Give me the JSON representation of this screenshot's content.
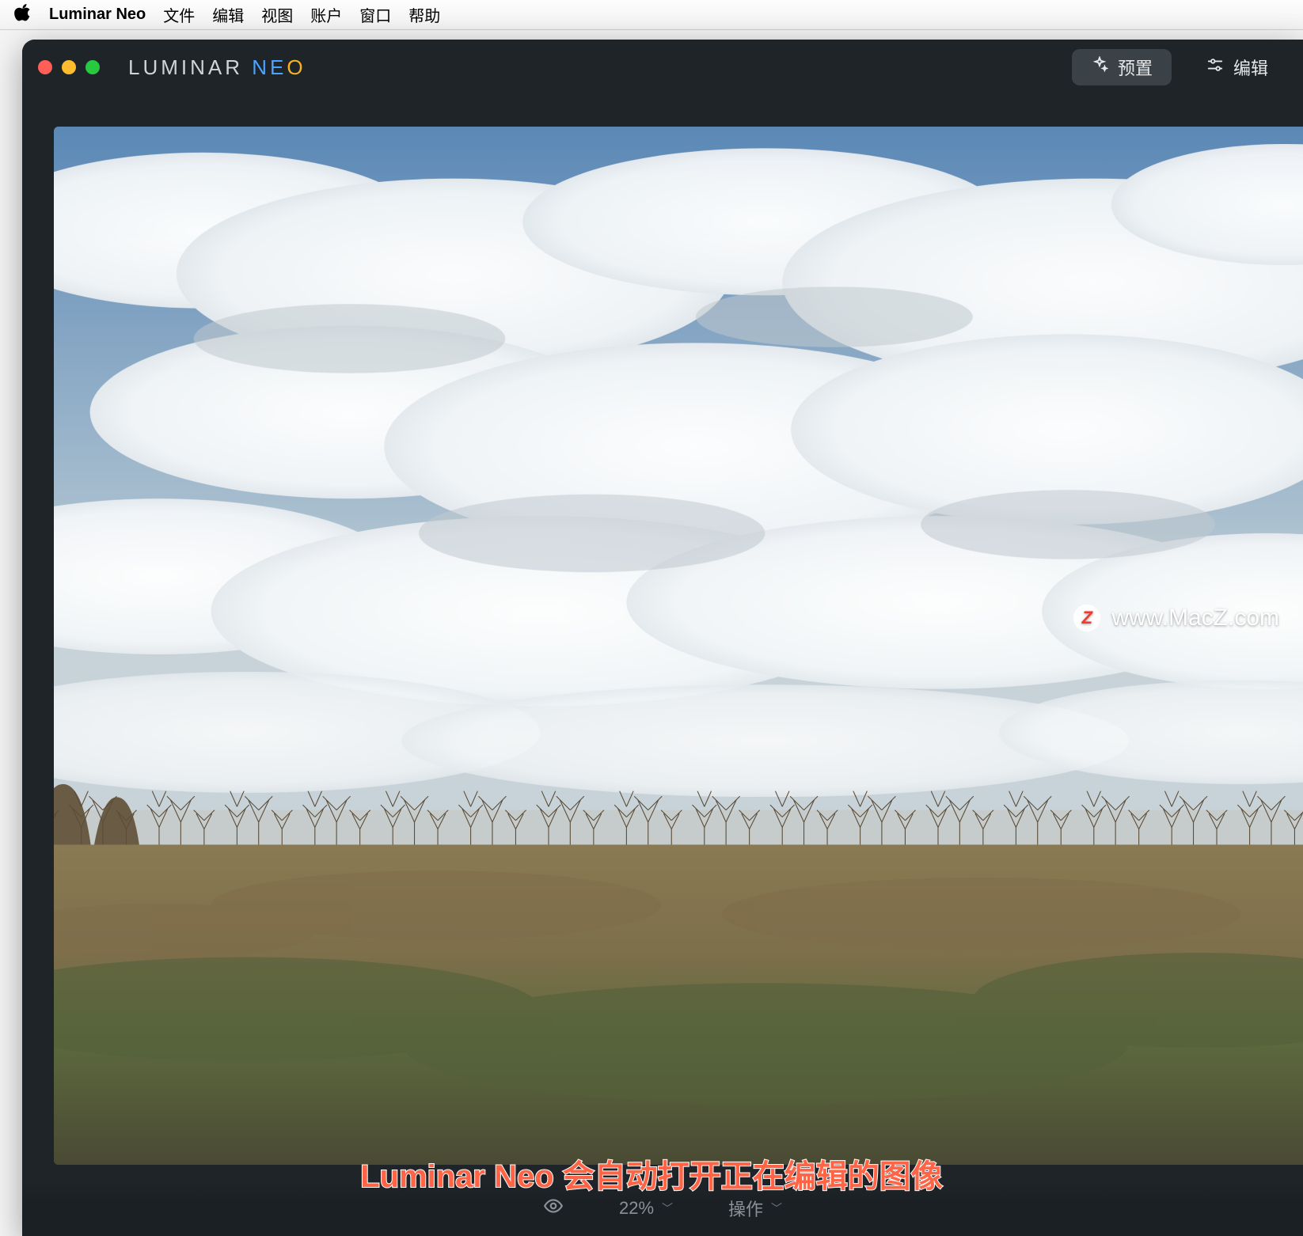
{
  "menubar": {
    "app_name": "Luminar Neo",
    "items": [
      "文件",
      "编辑",
      "视图",
      "账户",
      "窗口",
      "帮助"
    ]
  },
  "brand": {
    "part_a": "LUMINAR ",
    "part_b": "NE",
    "part_c": "O"
  },
  "modes": {
    "presets": "预置",
    "edit": "编辑"
  },
  "watermark": {
    "badge": "Z",
    "text": "www.MacZ.com"
  },
  "status": {
    "zoom": "22%",
    "actions": "操作"
  },
  "caption": "Luminar Neo 会自动打开正在编辑的图像"
}
